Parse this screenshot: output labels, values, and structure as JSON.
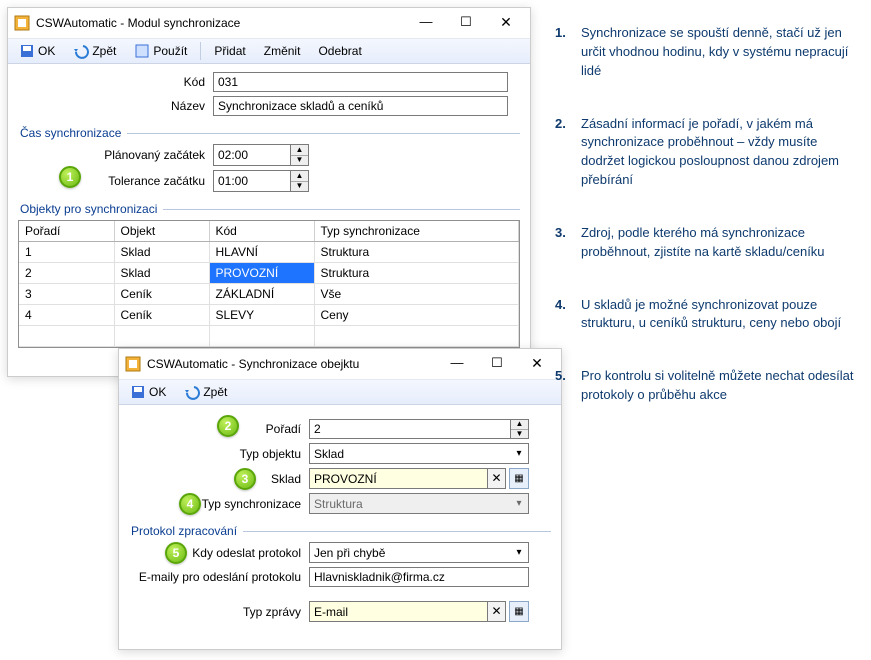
{
  "window_main": {
    "title": "CSWAutomatic - Modul synchronizace",
    "toolbar": {
      "ok": "OK",
      "back": "Zpět",
      "use": "Použít",
      "add": "Přidat",
      "edit": "Změnit",
      "remove": "Odebrat"
    },
    "fields": {
      "kod_label": "Kód",
      "kod_value": "031",
      "nazev_label": "Název",
      "nazev_value": "Synchronizace skladů a ceníků"
    },
    "group_time": "Čas synchronizace",
    "time": {
      "plan_label": "Plánovaný začátek",
      "plan_value": "02:00",
      "tol_label": "Tolerance začátku",
      "tol_value": "01:00"
    },
    "group_objs": "Objekty pro synchronizaci",
    "table": {
      "headers": {
        "poradi": "Pořadí",
        "objekt": "Objekt",
        "kod": "Kód",
        "typ": "Typ synchronizace"
      },
      "rows": [
        {
          "poradi": "1",
          "objekt": "Sklad",
          "kod": "HLAVNÍ",
          "typ": "Struktura",
          "sel": false
        },
        {
          "poradi": "2",
          "objekt": "Sklad",
          "kod": "PROVOZNÍ",
          "typ": "Struktura",
          "sel": true
        },
        {
          "poradi": "3",
          "objekt": "Ceník",
          "kod": "ZÁKLADNÍ",
          "typ": "Vše",
          "sel": false
        },
        {
          "poradi": "4",
          "objekt": "Ceník",
          "kod": "SLEVY",
          "typ": "Ceny",
          "sel": false
        }
      ],
      "blank_row": ""
    }
  },
  "window_sub": {
    "title": "CSWAutomatic - Synchronizace obejktu",
    "toolbar": {
      "ok": "OK",
      "back": "Zpět"
    },
    "fields": {
      "poradi_label": "Pořadí",
      "poradi_value": "2",
      "typobj_label": "Typ objektu",
      "typobj_value": "Sklad",
      "sklad_label": "Sklad",
      "sklad_value": "PROVOZNÍ",
      "typsync_label": "Typ synchronizace",
      "typsync_value": "Struktura"
    },
    "group_proto": "Protokol zpracování",
    "proto": {
      "kdy_label": "Kdy odeslat protokol",
      "kdy_value": "Jen při chybě",
      "emails_label": "E-maily pro odeslání protokolu",
      "emails_value": "Hlavniskladnik@firma.cz",
      "typ_label": "Typ zprávy",
      "typ_value": "E-mail"
    }
  },
  "notes": [
    "Synchronizace se spouští denně, stačí už jen určit vhodnou hodinu, kdy v systému nepracují lidé",
    "Zásadní informací je pořadí, v jakém má synchronizace proběhnout – vždy musíte dodržet logickou posloupnost danou zdrojem přebírání",
    "Zdroj, podle kterého má synchronizace proběhnout, zjistíte na kartě skladu/ceníku",
    "U skladů je možné synchronizovat pouze strukturu, u ceníků strukturu, ceny nebo obojí",
    "Pro kontrolu si volitelně můžete nechat odesílat protokoly o průběhu akce"
  ],
  "note_nums": [
    "1.",
    "2.",
    "3.",
    "4.",
    "5."
  ],
  "badges": {
    "b1": "1",
    "b2": "2",
    "b3": "3",
    "b4": "4",
    "b5": "5"
  }
}
